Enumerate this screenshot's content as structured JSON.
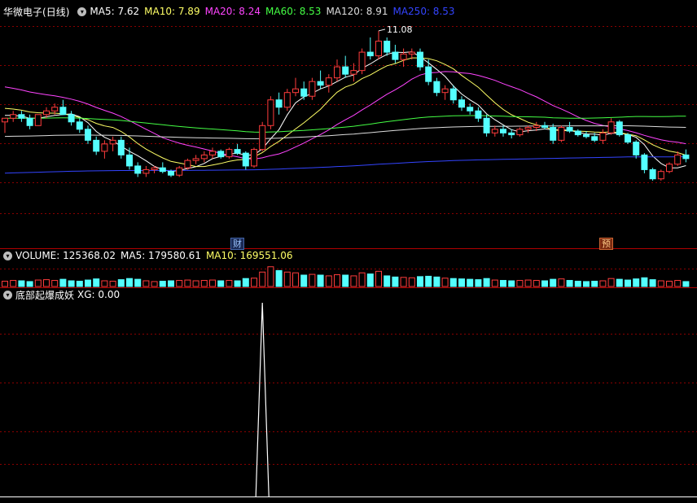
{
  "header_main": {
    "stock": "华微电子",
    "period": "(日线)",
    "ma": [
      {
        "label": "MA5: 7.62",
        "color": "#ffffff"
      },
      {
        "label": "MA10: 7.89",
        "color": "#ffff66"
      },
      {
        "label": "MA20: 8.24",
        "color": "#ff44ff"
      },
      {
        "label": "MA60: 8.53",
        "color": "#44ff44"
      },
      {
        "label": "MA120: 8.91",
        "color": "#dddddd"
      },
      {
        "label": "MA250: 8.53",
        "color": "#3344ff"
      }
    ]
  },
  "header_volume": {
    "volume": "VOLUME: 125368.02",
    "ma5": "MA5: 179580.61",
    "ma10": "MA10: 169551.06"
  },
  "header_indicator": {
    "name": "底部起爆成妖",
    "xg": "XG: 0.00"
  },
  "tags": {
    "cai": "财",
    "yu": "预"
  },
  "colors": {
    "up": "#ff3c3c",
    "down": "#54ffff",
    "ma5": "#ffffff",
    "ma10": "#ffff66",
    "ma20": "#ff44ff",
    "ma60": "#44ff44",
    "ma120": "#dddddd",
    "ma250": "#3344ff",
    "grid": "#8b0000",
    "separator": "#b00000"
  },
  "chart_data": {
    "type": "candlestick",
    "price_axis_range": [
      6.6,
      11.3
    ],
    "max_label": "11.08",
    "candles": [
      [
        8.6,
        8.7,
        8.3,
        8.7
      ],
      [
        8.7,
        8.9,
        8.6,
        8.8
      ],
      [
        8.8,
        8.9,
        8.6,
        8.7
      ],
      [
        8.7,
        8.8,
        8.4,
        8.5
      ],
      [
        8.5,
        8.8,
        8.5,
        8.8
      ],
      [
        8.8,
        9.0,
        8.7,
        8.9
      ],
      [
        8.9,
        9.1,
        8.8,
        9.0
      ],
      [
        9.0,
        9.2,
        8.8,
        8.8
      ],
      [
        8.8,
        8.9,
        8.5,
        8.6
      ],
      [
        8.6,
        8.7,
        8.3,
        8.4
      ],
      [
        8.4,
        8.5,
        8.0,
        8.1
      ],
      [
        8.1,
        8.2,
        7.7,
        7.8
      ],
      [
        7.8,
        8.1,
        7.6,
        8.0
      ],
      [
        8.0,
        8.2,
        7.8,
        8.1
      ],
      [
        8.1,
        8.2,
        7.6,
        7.7
      ],
      [
        7.7,
        7.9,
        7.3,
        7.4
      ],
      [
        7.4,
        7.5,
        7.1,
        7.2
      ],
      [
        7.2,
        7.4,
        7.1,
        7.3
      ],
      [
        7.3,
        7.4,
        7.2,
        7.35
      ],
      [
        7.35,
        7.5,
        7.2,
        7.25
      ],
      [
        7.25,
        7.3,
        7.1,
        7.15
      ],
      [
        7.15,
        7.4,
        7.1,
        7.35
      ],
      [
        7.35,
        7.6,
        7.3,
        7.55
      ],
      [
        7.55,
        7.7,
        7.45,
        7.6
      ],
      [
        7.6,
        7.8,
        7.5,
        7.7
      ],
      [
        7.7,
        7.9,
        7.6,
        7.8
      ],
      [
        7.8,
        7.85,
        7.6,
        7.65
      ],
      [
        7.65,
        7.9,
        7.6,
        7.85
      ],
      [
        7.85,
        8.0,
        7.7,
        7.75
      ],
      [
        7.75,
        7.8,
        7.3,
        7.4
      ],
      [
        7.4,
        7.9,
        7.35,
        7.85
      ],
      [
        7.85,
        8.6,
        7.8,
        8.5
      ],
      [
        8.5,
        9.3,
        8.4,
        9.2
      ],
      [
        9.2,
        9.4,
        8.8,
        9.0
      ],
      [
        9.0,
        9.5,
        8.9,
        9.4
      ],
      [
        9.4,
        9.8,
        9.3,
        9.5
      ],
      [
        9.5,
        9.7,
        9.2,
        9.3
      ],
      [
        9.3,
        9.8,
        9.2,
        9.7
      ],
      [
        9.7,
        10.0,
        9.5,
        9.6
      ],
      [
        9.6,
        9.9,
        9.4,
        9.8
      ],
      [
        9.8,
        10.3,
        9.7,
        10.1
      ],
      [
        10.1,
        10.4,
        9.8,
        9.9
      ],
      [
        9.9,
        10.2,
        9.7,
        10.0
      ],
      [
        10.0,
        10.6,
        9.9,
        10.5
      ],
      [
        10.5,
        10.9,
        10.3,
        10.4
      ],
      [
        10.4,
        11.08,
        10.3,
        10.8
      ],
      [
        10.8,
        10.9,
        10.4,
        10.5
      ],
      [
        10.5,
        10.7,
        10.2,
        10.3
      ],
      [
        10.3,
        10.6,
        10.1,
        10.45
      ],
      [
        10.45,
        10.6,
        10.3,
        10.5
      ],
      [
        10.5,
        10.6,
        10.0,
        10.1
      ],
      [
        10.1,
        10.3,
        9.6,
        9.7
      ],
      [
        9.7,
        9.8,
        9.3,
        9.4
      ],
      [
        9.4,
        9.6,
        9.2,
        9.5
      ],
      [
        9.5,
        9.6,
        9.1,
        9.2
      ],
      [
        9.2,
        9.3,
        8.9,
        9.0
      ],
      [
        9.0,
        9.1,
        8.8,
        8.9
      ],
      [
        8.9,
        9.0,
        8.6,
        8.7
      ],
      [
        8.7,
        8.8,
        8.2,
        8.3
      ],
      [
        8.3,
        8.5,
        8.2,
        8.4
      ],
      [
        8.4,
        8.5,
        8.2,
        8.3
      ],
      [
        8.3,
        8.4,
        8.15,
        8.25
      ],
      [
        8.25,
        8.45,
        8.2,
        8.4
      ],
      [
        8.4,
        8.5,
        8.3,
        8.45
      ],
      [
        8.45,
        8.6,
        8.35,
        8.5
      ],
      [
        8.5,
        8.6,
        8.4,
        8.45
      ],
      [
        8.45,
        8.55,
        8.0,
        8.1
      ],
      [
        8.1,
        8.5,
        8.05,
        8.45
      ],
      [
        8.45,
        8.6,
        8.3,
        8.35
      ],
      [
        8.35,
        8.4,
        8.2,
        8.25
      ],
      [
        8.25,
        8.35,
        8.15,
        8.2
      ],
      [
        8.2,
        8.3,
        8.05,
        8.1
      ],
      [
        8.1,
        8.4,
        8.0,
        8.3
      ],
      [
        8.3,
        8.7,
        8.25,
        8.6
      ],
      [
        8.6,
        8.65,
        8.2,
        8.25
      ],
      [
        8.25,
        8.3,
        8.0,
        8.05
      ],
      [
        8.05,
        8.1,
        7.6,
        7.7
      ],
      [
        7.7,
        7.75,
        7.2,
        7.3
      ],
      [
        7.3,
        7.35,
        7.0,
        7.05
      ],
      [
        7.05,
        7.3,
        7.0,
        7.25
      ],
      [
        7.25,
        7.5,
        7.2,
        7.45
      ],
      [
        7.45,
        7.8,
        7.4,
        7.7
      ],
      [
        7.7,
        7.85,
        7.5,
        7.6
      ]
    ],
    "volume_range": [
      0,
      600000
    ],
    "volumes": [
      140000,
      160000,
      150000,
      130000,
      170000,
      180000,
      160000,
      190000,
      150000,
      140000,
      170000,
      200000,
      150000,
      140000,
      180000,
      210000,
      190000,
      150000,
      130000,
      140000,
      150000,
      160000,
      170000,
      150000,
      160000,
      170000,
      150000,
      160000,
      150000,
      210000,
      220000,
      380000,
      520000,
      420000,
      380000,
      360000,
      300000,
      320000,
      300000,
      280000,
      310000,
      300000,
      280000,
      360000,
      330000,
      400000,
      280000,
      250000,
      240000,
      230000,
      260000,
      270000,
      250000,
      220000,
      210000,
      200000,
      190000,
      180000,
      210000,
      170000,
      160000,
      150000,
      160000,
      170000,
      160000,
      150000,
      190000,
      200000,
      160000,
      140000,
      130000,
      140000,
      150000,
      210000,
      190000,
      170000,
      200000,
      230000,
      180000,
      150000,
      140000,
      160000,
      130000
    ],
    "indicator": {
      "name": "XG",
      "y_range": [
        0,
        1
      ],
      "spike_index": 31,
      "spike_value": 1
    }
  }
}
